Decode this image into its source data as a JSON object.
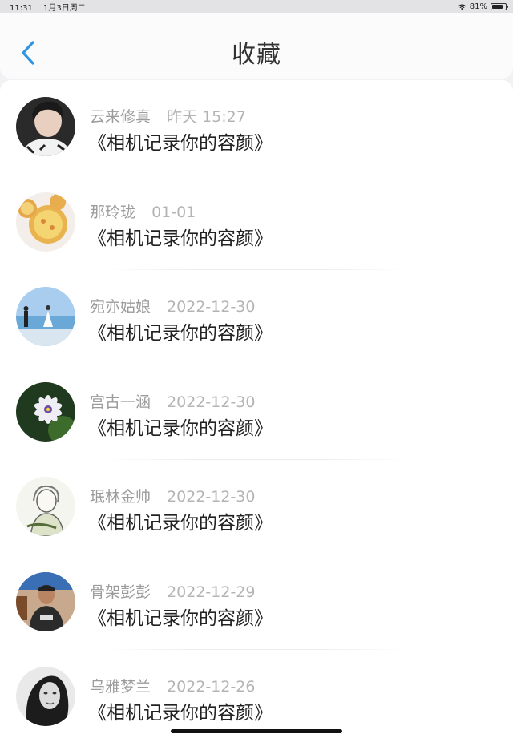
{
  "status_bar": {
    "time": "11:31",
    "date": "1月3日周二",
    "battery": "81%",
    "battery_level": 0.81,
    "wifi_icon": "wifi-icon",
    "battery_icon": "battery-icon"
  },
  "header": {
    "title": "收藏",
    "back_icon": "chevron-left-icon",
    "accent_color": "#2f95e0"
  },
  "items": [
    {
      "name": "云来修真",
      "time": "昨天 15:27",
      "title": "《相机记录你的容颜》",
      "avatar": "portrait-young-man"
    },
    {
      "name": "那玲珑",
      "time": "01-01",
      "title": "《相机记录你的容颜》",
      "avatar": "egg-tarts"
    },
    {
      "name": "宛亦姑娘",
      "time": "2022-12-30",
      "title": "《相机记录你的容颜》",
      "avatar": "couple-on-beach"
    },
    {
      "name": "宫古一涵",
      "time": "2022-12-30",
      "title": "《相机记录你的容颜》",
      "avatar": "purple-flower"
    },
    {
      "name": "珉林金帅",
      "time": "2022-12-30",
      "title": "《相机记录你的容颜》",
      "avatar": "anime-sketch"
    },
    {
      "name": "骨架彭彭",
      "time": "2022-12-29",
      "title": "《相机记录你的容颜》",
      "avatar": "man-in-room"
    },
    {
      "name": "乌雅梦兰",
      "time": "2022-12-26",
      "title": "《相机记录你的容颜》",
      "avatar": "woman-black-white"
    }
  ]
}
